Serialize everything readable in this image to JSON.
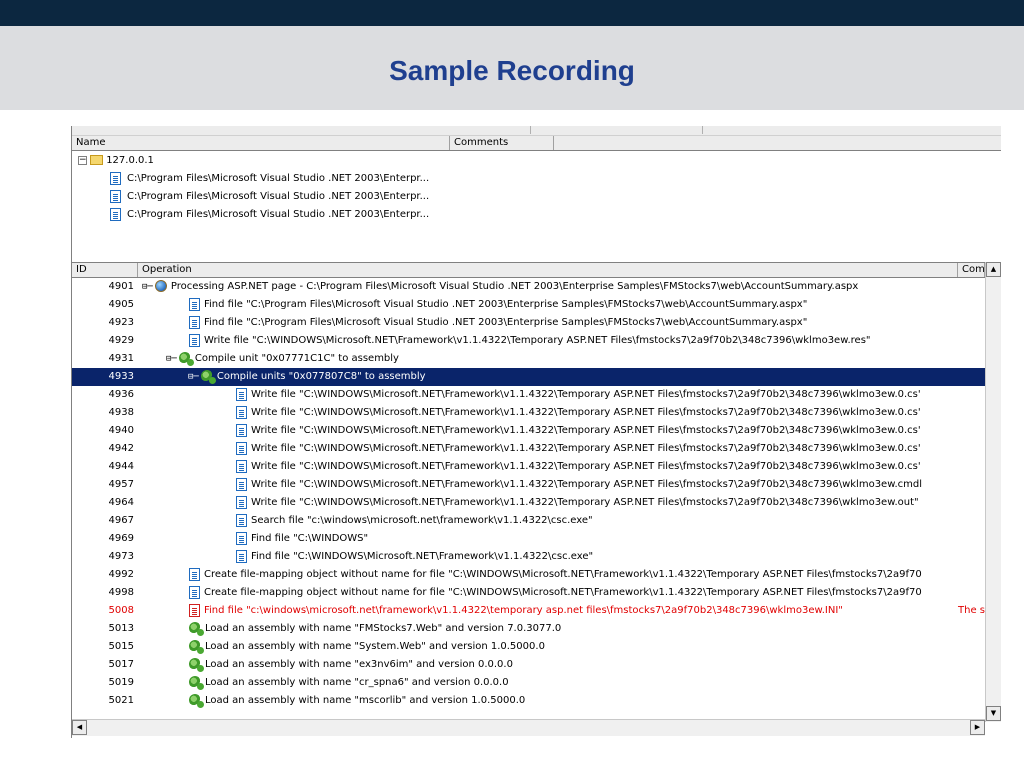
{
  "slide": {
    "title": "Sample Recording"
  },
  "session_pane": {
    "columns": {
      "name": "Name",
      "comments": "Comments"
    },
    "root": {
      "label": "127.0.0.1",
      "expander": "−"
    },
    "items": [
      {
        "label": "C:\\Program Files\\Microsoft Visual Studio .NET 2003\\Enterpr..."
      },
      {
        "label": "C:\\Program Files\\Microsoft Visual Studio .NET 2003\\Enterpr..."
      },
      {
        "label": "C:\\Program Files\\Microsoft Visual Studio .NET 2003\\Enterpr..."
      }
    ]
  },
  "ops_pane": {
    "columns": {
      "id": "ID",
      "operation": "Operation",
      "comments": "Comm"
    },
    "rows": [
      {
        "id": "4901",
        "icon": "globe-icon",
        "tree": "⊟─",
        "op": "Processing ASP.NET page - C:\\Program Files\\Microsoft Visual Studio .NET 2003\\Enterprise Samples\\FMStocks7\\web\\AccountSummary.aspx"
      },
      {
        "id": "4905",
        "icon": "document-icon",
        "op": "Find file \"C:\\Program Files\\Microsoft Visual Studio .NET 2003\\Enterprise Samples\\FMStocks7\\web\\AccountSummary.aspx\""
      },
      {
        "id": "4923",
        "icon": "document-icon",
        "op": "Find file \"C:\\Program Files\\Microsoft Visual Studio .NET 2003\\Enterprise Samples\\FMStocks7\\web\\AccountSummary.aspx\""
      },
      {
        "id": "4929",
        "icon": "document-icon",
        "op": "Write file \"C:\\WINDOWS\\Microsoft.NET\\Framework\\v1.1.4322\\Temporary ASP.NET Files\\fmstocks7\\2a9f70b2\\348c7396\\wklmo3ew.res\""
      },
      {
        "id": "4931",
        "icon": "gear-icon",
        "tree": "⊟─",
        "op": "Compile unit \"0x07771C1C\" to assembly"
      },
      {
        "id": "4933",
        "icon": "gear-icon",
        "tree": "⊟─",
        "op": "Compile units \"0x077807C8\" to assembly",
        "selected": true
      },
      {
        "id": "4936",
        "icon": "document-icon",
        "op": "Write file \"C:\\WINDOWS\\Microsoft.NET\\Framework\\v1.1.4322\\Temporary ASP.NET Files\\fmstocks7\\2a9f70b2\\348c7396\\wklmo3ew.0.cs'"
      },
      {
        "id": "4938",
        "icon": "document-icon",
        "op": "Write file \"C:\\WINDOWS\\Microsoft.NET\\Framework\\v1.1.4322\\Temporary ASP.NET Files\\fmstocks7\\2a9f70b2\\348c7396\\wklmo3ew.0.cs'"
      },
      {
        "id": "4940",
        "icon": "document-icon",
        "op": "Write file \"C:\\WINDOWS\\Microsoft.NET\\Framework\\v1.1.4322\\Temporary ASP.NET Files\\fmstocks7\\2a9f70b2\\348c7396\\wklmo3ew.0.cs'"
      },
      {
        "id": "4942",
        "icon": "document-icon",
        "op": "Write file \"C:\\WINDOWS\\Microsoft.NET\\Framework\\v1.1.4322\\Temporary ASP.NET Files\\fmstocks7\\2a9f70b2\\348c7396\\wklmo3ew.0.cs'"
      },
      {
        "id": "4944",
        "icon": "document-icon",
        "op": "Write file \"C:\\WINDOWS\\Microsoft.NET\\Framework\\v1.1.4322\\Temporary ASP.NET Files\\fmstocks7\\2a9f70b2\\348c7396\\wklmo3ew.0.cs'"
      },
      {
        "id": "4957",
        "icon": "document-icon",
        "op": "Write file \"C:\\WINDOWS\\Microsoft.NET\\Framework\\v1.1.4322\\Temporary ASP.NET Files\\fmstocks7\\2a9f70b2\\348c7396\\wklmo3ew.cmdl"
      },
      {
        "id": "4964",
        "icon": "document-icon",
        "op": "Write file \"C:\\WINDOWS\\Microsoft.NET\\Framework\\v1.1.4322\\Temporary ASP.NET Files\\fmstocks7\\2a9f70b2\\348c7396\\wklmo3ew.out\""
      },
      {
        "id": "4967",
        "icon": "document-icon",
        "op": "Search file \"c:\\windows\\microsoft.net\\framework\\v1.1.4322\\csc.exe\""
      },
      {
        "id": "4969",
        "icon": "document-icon",
        "op": "Find file \"C:\\WINDOWS\""
      },
      {
        "id": "4973",
        "icon": "document-icon",
        "op": "Find file \"C:\\WINDOWS\\Microsoft.NET\\Framework\\v1.1.4322\\csc.exe\""
      },
      {
        "id": "4992",
        "icon": "document-icon",
        "op": "Create file-mapping object without name for file \"C:\\WINDOWS\\Microsoft.NET\\Framework\\v1.1.4322\\Temporary ASP.NET Files\\fmstocks7\\2a9f70"
      },
      {
        "id": "4998",
        "icon": "document-icon",
        "op": "Create file-mapping object without name for file \"C:\\WINDOWS\\Microsoft.NET\\Framework\\v1.1.4322\\Temporary ASP.NET Files\\fmstocks7\\2a9f70"
      },
      {
        "id": "5008",
        "icon": "document-icon",
        "op": "Find file \"c:\\windows\\microsoft.net\\framework\\v1.1.4322\\temporary asp.net files\\fmstocks7\\2a9f70b2\\348c7396\\wklmo3ew.INI\"",
        "comment": "The s",
        "error": true
      },
      {
        "id": "5013",
        "icon": "gear-icon",
        "op": "Load an assembly with name \"FMStocks7.Web\" and version 7.0.3077.0"
      },
      {
        "id": "5015",
        "icon": "gear-icon",
        "op": "Load an assembly with name \"System.Web\" and version 1.0.5000.0"
      },
      {
        "id": "5017",
        "icon": "gear-icon",
        "op": "Load an assembly with name \"ex3nv6im\" and version 0.0.0.0"
      },
      {
        "id": "5019",
        "icon": "gear-icon",
        "op": "Load an assembly with name \"cr_spna6\" and version 0.0.0.0"
      },
      {
        "id": "5021",
        "icon": "gear-icon",
        "op": "Load an assembly with name \"mscorlib\" and version 1.0.5000.0"
      }
    ]
  }
}
